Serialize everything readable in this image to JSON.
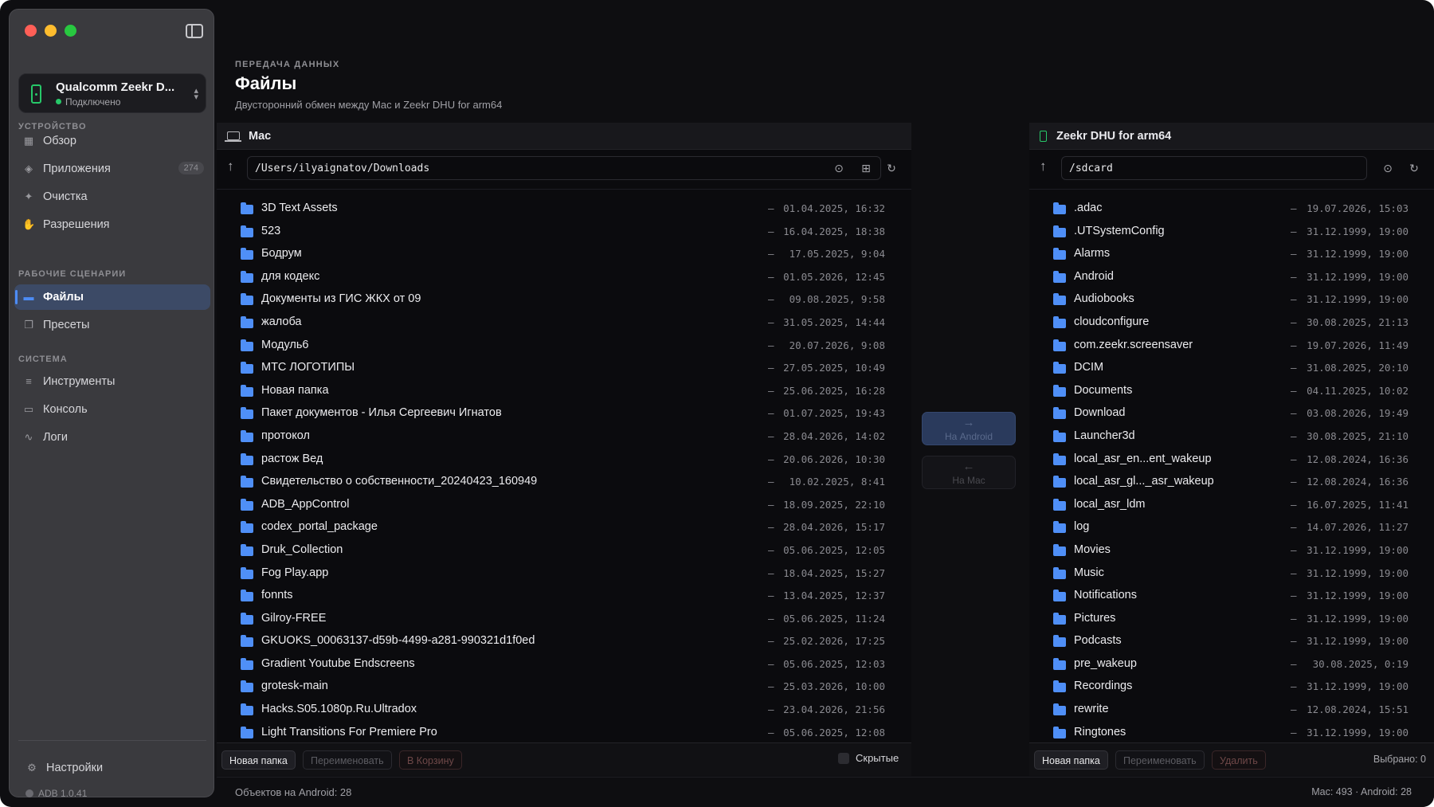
{
  "sidebar": {
    "device": {
      "name": "Qualcomm Zeekr D...",
      "status": "Подключено"
    },
    "sections": [
      {
        "title": "УСТРОЙСТВО"
      },
      {
        "title": "РАБОЧИЕ СЦЕНАРИИ"
      },
      {
        "title": "СИСТЕМА"
      }
    ],
    "items": [
      {
        "label": "Обзор",
        "icon": "grid-icon"
      },
      {
        "label": "Приложения",
        "icon": "layers-icon",
        "badge": "274"
      },
      {
        "label": "Очистка",
        "icon": "sparkle-icon"
      },
      {
        "label": "Разрешения",
        "icon": "hand-icon"
      },
      {
        "label": "Файлы",
        "icon": "folder-icon",
        "active": true
      },
      {
        "label": "Пресеты",
        "icon": "presets-icon"
      },
      {
        "label": "Инструменты",
        "icon": "sliders-icon"
      },
      {
        "label": "Консоль",
        "icon": "terminal-icon"
      },
      {
        "label": "Логи",
        "icon": "pulse-icon"
      }
    ],
    "settings_label": "Настройки",
    "adb_version": "ADB 1.0.41"
  },
  "header": {
    "eyebrow": "ПЕРЕДАЧА ДАННЫХ",
    "title": "Файлы",
    "subtitle": "Двусторонний обмен между Mac и Zeekr DHU for arm64"
  },
  "left_pane": {
    "title": "Mac",
    "path": "/Users/ilyaignatov/Downloads",
    "files": [
      {
        "name": "3D Text Assets",
        "size": "—",
        "date": "01.04.2025, 16:32"
      },
      {
        "name": "523",
        "size": "—",
        "date": "16.04.2025, 18:38"
      },
      {
        "name": "Бодрум",
        "size": "—",
        "date": "17.05.2025, 9:04"
      },
      {
        "name": "для кодекс",
        "size": "—",
        "date": "01.05.2026, 12:45"
      },
      {
        "name": "Документы из ГИС ЖКХ от 09",
        "size": "—",
        "date": "09.08.2025, 9:58"
      },
      {
        "name": "жалоба",
        "size": "—",
        "date": "31.05.2025, 14:44"
      },
      {
        "name": "Модуль6",
        "size": "—",
        "date": "20.07.2026, 9:08"
      },
      {
        "name": "МТС ЛОГОТИПЫ",
        "size": "—",
        "date": "27.05.2025, 10:49"
      },
      {
        "name": "Новая папка",
        "size": "—",
        "date": "25.06.2025, 16:28"
      },
      {
        "name": "Пакет документов - Илья Сергеевич Игнатов",
        "size": "—",
        "date": "01.07.2025, 19:43"
      },
      {
        "name": "протокол",
        "size": "—",
        "date": "28.04.2026, 14:02"
      },
      {
        "name": "растож Вед",
        "size": "—",
        "date": "20.06.2026, 10:30"
      },
      {
        "name": "Свидетельство о собственности_20240423_160949",
        "size": "—",
        "date": "10.02.2025, 8:41"
      },
      {
        "name": "ADB_AppControl",
        "size": "—",
        "date": "18.09.2025, 22:10"
      },
      {
        "name": "codex_portal_package",
        "size": "—",
        "date": "28.04.2026, 15:17"
      },
      {
        "name": "Druk_Collection",
        "size": "—",
        "date": "05.06.2025, 12:05"
      },
      {
        "name": "Fog Play.app",
        "size": "—",
        "date": "18.04.2025, 15:27"
      },
      {
        "name": "fonnts",
        "size": "—",
        "date": "13.04.2025, 12:37"
      },
      {
        "name": "Gilroy-FREE",
        "size": "—",
        "date": "05.06.2025, 11:24"
      },
      {
        "name": "GKUOKS_00063137-d59b-4499-a281-990321d1f0ed",
        "size": "—",
        "date": "25.02.2026, 17:25"
      },
      {
        "name": "Gradient Youtube Endscreens",
        "size": "—",
        "date": "05.06.2025, 12:03"
      },
      {
        "name": "grotesk-main",
        "size": "—",
        "date": "25.03.2026, 10:00"
      },
      {
        "name": "Hacks.S05.1080p.Ru.Ultradox",
        "size": "—",
        "date": "23.04.2026, 21:56"
      },
      {
        "name": "Light Transitions For Premiere Pro",
        "size": "—",
        "date": "05.06.2025, 12:08"
      }
    ],
    "footer": {
      "new_folder": "Новая папка",
      "rename": "Переименовать",
      "trash": "В Корзину",
      "hidden_label": "Скрытые"
    }
  },
  "transfer": {
    "to_android": "На Android",
    "to_mac": "На Mac"
  },
  "right_pane": {
    "title": "Zeekr DHU for arm64",
    "path": "/sdcard",
    "files": [
      {
        "name": ".adac",
        "size": "—",
        "date": "19.07.2026, 15:03"
      },
      {
        "name": ".UTSystemConfig",
        "size": "—",
        "date": "31.12.1999, 19:00"
      },
      {
        "name": "Alarms",
        "size": "—",
        "date": "31.12.1999, 19:00"
      },
      {
        "name": "Android",
        "size": "—",
        "date": "31.12.1999, 19:00"
      },
      {
        "name": "Audiobooks",
        "size": "—",
        "date": "31.12.1999, 19:00"
      },
      {
        "name": "cloudconfigure",
        "size": "—",
        "date": "30.08.2025, 21:13"
      },
      {
        "name": "com.zeekr.screensaver",
        "size": "—",
        "date": "19.07.2026, 11:49"
      },
      {
        "name": "DCIM",
        "size": "—",
        "date": "31.08.2025, 20:10"
      },
      {
        "name": "Documents",
        "size": "—",
        "date": "04.11.2025, 10:02"
      },
      {
        "name": "Download",
        "size": "—",
        "date": "03.08.2026, 19:49"
      },
      {
        "name": "Launcher3d",
        "size": "—",
        "date": "30.08.2025, 21:10"
      },
      {
        "name": "local_asr_en...ent_wakeup",
        "size": "—",
        "date": "12.08.2024, 16:36"
      },
      {
        "name": "local_asr_gl..._asr_wakeup",
        "size": "—",
        "date": "12.08.2024, 16:36"
      },
      {
        "name": "local_asr_ldm",
        "size": "—",
        "date": "16.07.2025, 11:41"
      },
      {
        "name": "log",
        "size": "—",
        "date": "14.07.2026, 11:27"
      },
      {
        "name": "Movies",
        "size": "—",
        "date": "31.12.1999, 19:00"
      },
      {
        "name": "Music",
        "size": "—",
        "date": "31.12.1999, 19:00"
      },
      {
        "name": "Notifications",
        "size": "—",
        "date": "31.12.1999, 19:00"
      },
      {
        "name": "Pictures",
        "size": "—",
        "date": "31.12.1999, 19:00"
      },
      {
        "name": "Podcasts",
        "size": "—",
        "date": "31.12.1999, 19:00"
      },
      {
        "name": "pre_wakeup",
        "size": "—",
        "date": "30.08.2025, 0:19"
      },
      {
        "name": "Recordings",
        "size": "—",
        "date": "31.12.1999, 19:00"
      },
      {
        "name": "rewrite",
        "size": "—",
        "date": "12.08.2024, 15:51"
      },
      {
        "name": "Ringtones",
        "size": "—",
        "date": "31.12.1999, 19:00"
      }
    ],
    "footer": {
      "new_folder": "Новая папка",
      "rename": "Переименовать",
      "delete": "Удалить",
      "selected": "Выбрано: 0"
    }
  },
  "status_bar": {
    "left": "Объектов на Android: 28",
    "right": "Mac: 493 · Android: 28"
  },
  "colors": {
    "accent": "#4d8cf5",
    "connected": "#27c869",
    "folder": "#4f8ff7"
  }
}
